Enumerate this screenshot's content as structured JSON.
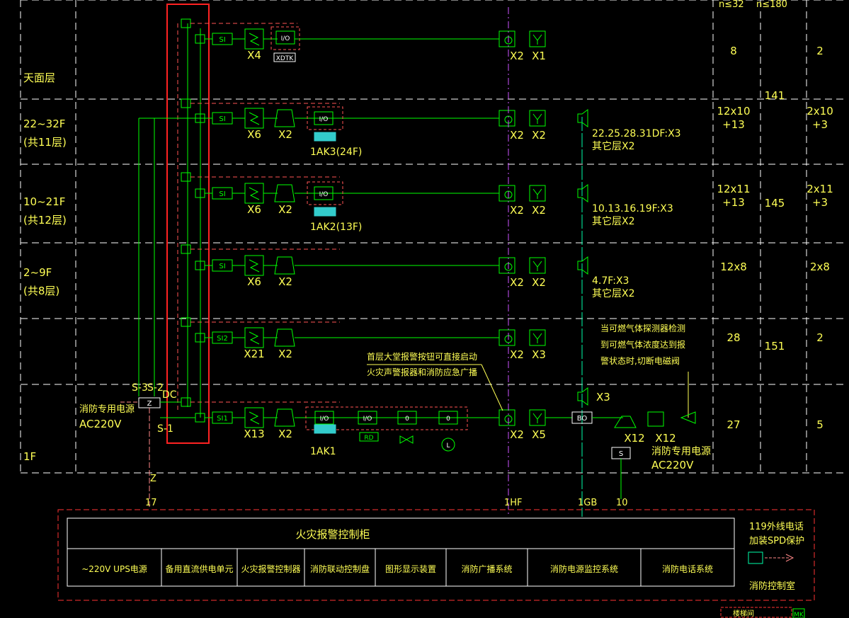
{
  "colors": {
    "background": "#000000",
    "label": "#ffff55",
    "wire": "#00ff00",
    "grid": "#ffffff",
    "dashed_loop": "#ff5555",
    "highlight_box": "#ff2222",
    "broadcast_line": "#00ffaa",
    "fire_alarm_bus": "#cc55ff",
    "power_line": "#ff8888",
    "panel_border": "#ff3333",
    "panel_text": "#ffff55",
    "module_fill": "#33cccc"
  },
  "header": {
    "col1": "n≤32",
    "col2": "n≤180"
  },
  "floors": [
    {
      "name": "天面层",
      "sub": "",
      "si": "SI",
      "sensor_qty": "X4",
      "loud_qty": "",
      "alarm_qty": "X2",
      "bell_qty": "X1",
      "count1": "8",
      "count2": "2"
    },
    {
      "name": "22~32F",
      "sub": "(共11层)",
      "si": "SI",
      "sensor_qty": "X6",
      "loud_qty": "X2",
      "alarm_qty": "X2",
      "bell_qty": "X2",
      "count1": "12x10",
      "count1b": "+13",
      "count2": "2x10",
      "count2b": "+3",
      "module": "1AK3(24F)",
      "speaker": "22.25.28.31DF:X3",
      "speaker2": "其它层X2"
    },
    {
      "name": "10~21F",
      "sub": "(共12层)",
      "si": "SI",
      "sensor_qty": "X6",
      "loud_qty": "X2",
      "alarm_qty": "X2",
      "bell_qty": "X2",
      "count1": "12x11",
      "count1b": "+13",
      "count2": "2x11",
      "count2b": "+3",
      "module": "1AK2(13F)",
      "speaker": "10.13.16.19F:X3",
      "speaker2": "其它层X2"
    },
    {
      "name": "2~9F",
      "sub": "(共8层)",
      "si": "SI",
      "sensor_qty": "X6",
      "loud_qty": "X2",
      "alarm_qty": "X2",
      "bell_qty": "X2",
      "count1": "12x8",
      "count2": "2x8",
      "speaker": "4.7F:X3",
      "speaker2": "其它层X2"
    },
    {
      "name": "",
      "sub": "",
      "si": "SI2",
      "sensor_qty": "X21",
      "loud_qty": "X2",
      "alarm_qty": "X2",
      "bell_qty": "X3",
      "count1": "28",
      "count2": "2"
    },
    {
      "name": "1F",
      "sub": "",
      "si": "SI1",
      "sensor_qty": "X13",
      "loud_qty": "X2",
      "alarm_qty": "X2",
      "bell_qty": "X5",
      "count1": "27",
      "count2": "5",
      "module": "1AK1"
    }
  ],
  "totals": {
    "t1": "141",
    "t2": "145",
    "t3": "151"
  },
  "labels": {
    "xdtk": "XDTK",
    "io": "I/O",
    "rd": "RD",
    "zero": "0",
    "l": "L",
    "bo": "BO",
    "s": "S",
    "z": "Z",
    "dc": "DC",
    "s1": "S-1",
    "s2": "S-2",
    "s3": "S-3",
    "x3_speaker": "X3",
    "x12a": "X12",
    "x12b": "X12",
    "power_left_1": "消防专用电源",
    "power_left_2": "AC220V",
    "power_right_1": "消防专用电源",
    "power_right_2": "AC220V",
    "hall_note_1": "首层大堂报警按钮可直接启动",
    "hall_note_2": "火灾声警报器和消防应急广播",
    "gas_note_1": "当可燃气体探测器检测",
    "gas_note_2": "到可燃气体浓度达到报",
    "gas_note_3": "警状态时,切断电磁阀",
    "bus_17": "17",
    "bus_z": "Z",
    "bus_1hf": "1HF",
    "bus_1gb": "1GB",
    "bus_10": "10"
  },
  "panel": {
    "title": "火灾报警控制柜",
    "cells": [
      "~220V  UPS电源",
      "备用直流供电单元",
      "火灾报警控制器",
      "消防联动控制盘",
      "图形显示装置",
      "消防广播系统",
      "消防电源监控系统",
      "消防电话系统"
    ],
    "right_1": "119外线电话",
    "right_2": "加装SPD保护",
    "room": "消防控制室"
  },
  "footer_fragment": "楼梯间",
  "footer_tag": "MK"
}
